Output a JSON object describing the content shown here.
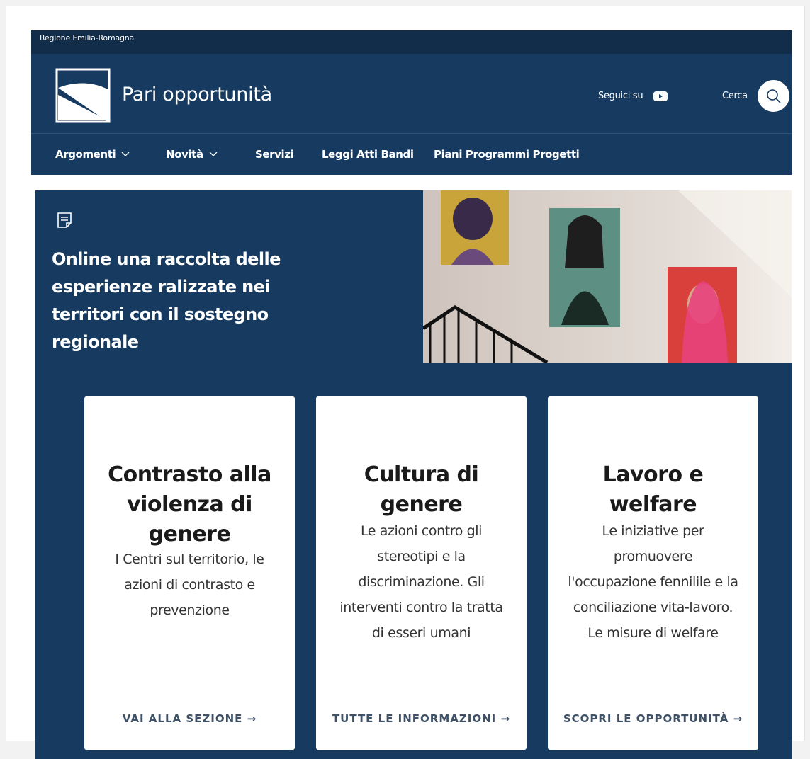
{
  "topbar": {
    "region": "Regione Emilia-Romagna"
  },
  "header": {
    "site_title": "Pari opportunità",
    "follow_label": "Seguici su",
    "search_label": "Cerca"
  },
  "nav": {
    "items": [
      {
        "label": "Argomenti",
        "has_dropdown": true
      },
      {
        "label": "Novità",
        "has_dropdown": true
      },
      {
        "label": "Servizi",
        "has_dropdown": false
      },
      {
        "label": "Leggi Atti Bandi",
        "has_dropdown": false
      },
      {
        "label": "Piani Programmi Progetti",
        "has_dropdown": false
      }
    ]
  },
  "hero": {
    "title": "Online una raccolta delle esperienze ralizzate nei territori con il sostegno regionale"
  },
  "cards": [
    {
      "title": "Contrasto alla violenza di genere",
      "description": "I Centri sul territorio, le azioni di contrasto e prevenzione",
      "cta": "VAI ALLA SEZIONE →"
    },
    {
      "title": "Cultura di genere",
      "description": "Le azioni contro gli stereotipi e la discriminazione. Gli interventi contro la tratta di esseri umani",
      "cta": "TUTTE LE INFORMAZIONI →"
    },
    {
      "title": "Lavoro e welfare",
      "description": "Le iniziative per promuovere l'occupazione fennilile e la conciliazione vita-lavoro. Le misure di welfare",
      "cta": "SCOPRI LE OPPORTUNITÀ →"
    }
  ],
  "colors": {
    "primary": "#173a60",
    "topbar": "#112d4a",
    "cta_text": "#3e5166"
  },
  "icons": {
    "logo": "region-logo-icon",
    "youtube": "youtube-icon",
    "search": "search-icon",
    "chevron": "chevron-down-icon",
    "hero": "document-icon"
  }
}
